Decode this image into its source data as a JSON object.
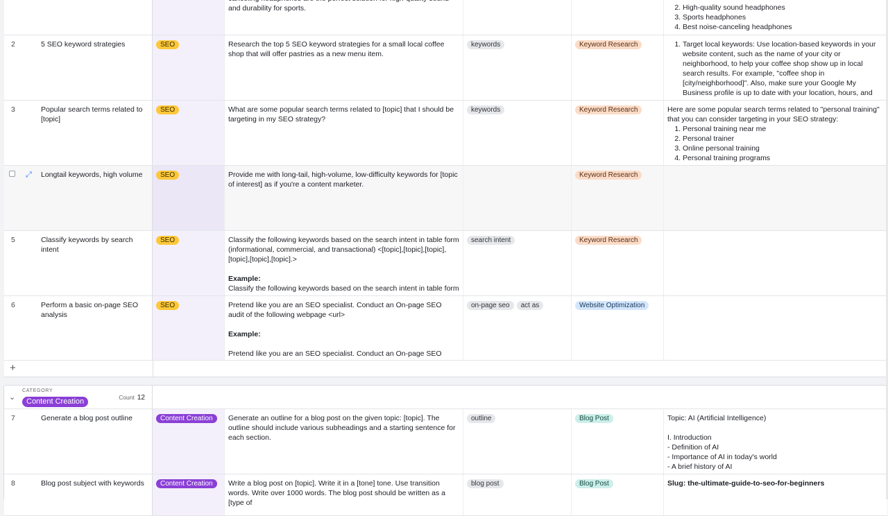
{
  "rows_top": [
    {
      "num": "",
      "title": "",
      "category": "",
      "prompt": "canceling headphones are the perfect solution for high-quality sound and durability for sports.",
      "tags": [],
      "use_case": "",
      "example_list": [
        "High-quality sound headphones",
        "Sports headphones",
        "Best noise-canceling headphones"
      ],
      "example_start": 2
    },
    {
      "num": "2",
      "title": "5 SEO keyword strategies",
      "category": "SEO",
      "prompt": "Research the top 5 SEO keyword strategies for a small local coffee shop that will offer pastries as a new menu item.",
      "tags": [
        "keywords"
      ],
      "use_case": "Keyword Research",
      "example_list": [
        "Target local keywords: Use location-based keywords in your website content, such as the name of your city or neighborhood, to help your coffee shop show up in local search results. For example, \"coffee shop in [city/neighborhood]\". Also, make sure your Google My Business profile is up to date with your location, hours, and menu."
      ],
      "example_start": 1
    },
    {
      "num": "3",
      "title": "Popular search terms related to [topic]",
      "category": "SEO",
      "prompt": "What are some popular search terms related to [topic] that I should be targeting in my SEO strategy?",
      "tags": [
        "keywords"
      ],
      "use_case": "Keyword Research",
      "example_intro": "Here are some popular search terms related to \"personal training\" that you can consider targeting in your SEO strategy:",
      "example_list": [
        "Personal training near me",
        "Personal trainer",
        "Online personal training",
        "Personal training programs"
      ],
      "example_start": 1
    },
    {
      "num": "",
      "title": "Longtail keywords, high volume",
      "category": "SEO",
      "prompt": "Provide me with long-tail, high-volume, low-difficulty keywords for [topic of interest] as if you're a content marketer.",
      "tags": [],
      "use_case": "Keyword Research",
      "example_list": [],
      "example_start": 1
    },
    {
      "num": "5",
      "title": "Classify keywords by search intent",
      "category": "SEO",
      "prompt": "Classify the following keywords based on the search intent in table form (informational, commercial, and transactional) <[topic],[topic],[topic],[topic],[topic],[topic].>",
      "prompt_example_label": "Example:",
      "prompt_after": "Classify the following keywords based on the search intent in table form",
      "tags": [
        "search intent"
      ],
      "use_case": "Keyword Research",
      "example_list": [],
      "example_start": 1
    },
    {
      "num": "6",
      "title": "Perform a basic on-page SEO analysis",
      "category": "SEO",
      "prompt": "Pretend like you are an SEO specialist. Conduct an On-page SEO audit of the following webpage <url>",
      "prompt_example_label": "Example:",
      "prompt_after": "Pretend like you are an SEO specialist. Conduct an On-page SEO audit of",
      "tags": [
        "on-page seo",
        "act as"
      ],
      "use_case": "Website Optimization",
      "example_list": [],
      "example_start": 1
    }
  ],
  "group": {
    "label": "CATEGORY",
    "name": "Content Creation",
    "count_label": "Count",
    "count": "12"
  },
  "rows_bottom": [
    {
      "num": "7",
      "title": "Generate a blog post outline",
      "category": "Content Creation",
      "prompt": "Generate an outline for a blog post on the given topic: [topic]. The outline should include various subheadings and a starting sentence for each section.",
      "tags": [
        "outline"
      ],
      "use_case": "Blog Post",
      "example_lines": [
        "Topic: AI (Artificial Intelligence)",
        "",
        "I. Introduction",
        "- Definition of AI",
        "- Importance of AI in today's world",
        "- A brief history of AI"
      ]
    },
    {
      "num": "8",
      "title": "Blog post subject with keywords",
      "category": "Content Creation",
      "prompt": "Write a blog post on [topic]. Write it in a [tone] tone. Use transition words. Write over 1000 words. The blog post should be written as a [type of",
      "tags": [
        "blog post"
      ],
      "use_case": "Blog Post",
      "example_bold": "Slug: the-ultimate-guide-to-seo-for-beginners"
    }
  ],
  "colors": {
    "seo": "#fcc83a",
    "content_creation": "#8a3fd6",
    "keyword_research": "#fbdcc8",
    "website_optimization": "#d4e6fb",
    "blog_post": "#cdeee9"
  }
}
